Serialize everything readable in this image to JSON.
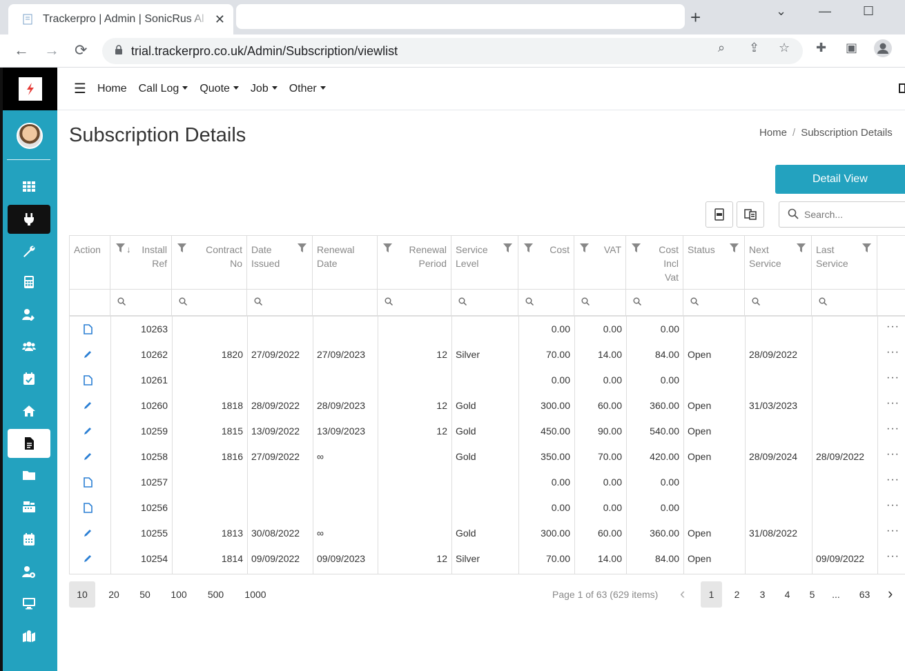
{
  "browser": {
    "tab_title": "Trackerpro | Admin | SonicRus Al",
    "url": "trial.trackerpro.co.uk/Admin/Subscription/viewlist"
  },
  "topnav": {
    "items": [
      {
        "label": "Home",
        "dropdown": false
      },
      {
        "label": "Call Log",
        "dropdown": true
      },
      {
        "label": "Quote",
        "dropdown": true
      },
      {
        "label": "Job",
        "dropdown": true
      },
      {
        "label": "Other",
        "dropdown": true
      }
    ]
  },
  "page": {
    "title": "Subscription Details",
    "breadcrumb": [
      "Home",
      "Subscription Details"
    ],
    "breadcrumb_sep": "/",
    "detail_view_label": "Detail View",
    "search_placeholder": "Search..."
  },
  "colors": {
    "accent": "#23a2bf",
    "sidebar_active": "#111111"
  },
  "sidebar": {
    "icons": [
      "dashboard-grid-icon",
      "plug-icon",
      "wrench-icon",
      "calculator-icon",
      "user-edit-icon",
      "users-icon",
      "calendar-check-icon",
      "home-icon",
      "document-icon",
      "folder-icon",
      "cash-register-icon",
      "calendar-icon",
      "user-cog-icon",
      "desktop-icon",
      "map-icon"
    ]
  },
  "grid": {
    "columns": [
      {
        "key": "action",
        "line1": "Action",
        "line2": "",
        "line3": ""
      },
      {
        "key": "install_ref",
        "line1": "Install",
        "line2": "Ref",
        "line3": ""
      },
      {
        "key": "contract_no",
        "line1": "Contract",
        "line2": "No",
        "line3": ""
      },
      {
        "key": "date_issued",
        "line1": "Date",
        "line2": "Issued",
        "line3": ""
      },
      {
        "key": "renewal_date",
        "line1": "Renewal",
        "line2": "Date",
        "line3": ""
      },
      {
        "key": "renewal_period",
        "line1": "Renewal",
        "line2": "Period",
        "line3": ""
      },
      {
        "key": "service_level",
        "line1": "Service",
        "line2": "Level",
        "line3": ""
      },
      {
        "key": "cost",
        "line1": "Cost",
        "line2": "",
        "line3": ""
      },
      {
        "key": "vat",
        "line1": "VAT",
        "line2": "",
        "line3": ""
      },
      {
        "key": "cost_incl_vat",
        "line1": "Cost",
        "line2": "Incl",
        "line3": "Vat"
      },
      {
        "key": "status",
        "line1": "Status",
        "line2": "",
        "line3": ""
      },
      {
        "key": "next_service",
        "line1": "Next",
        "line2": "Service",
        "line3": ""
      },
      {
        "key": "last_service",
        "line1": "Last",
        "line2": "Service",
        "line3": ""
      }
    ],
    "rows": [
      {
        "action": "view",
        "install_ref": "10263",
        "contract_no": "",
        "date_issued": "",
        "renewal_date": "",
        "renewal_period": "",
        "service_level": "",
        "cost": "0.00",
        "vat": "0.00",
        "cost_incl_vat": "0.00",
        "status": "",
        "next_service": "",
        "last_service": ""
      },
      {
        "action": "edit",
        "install_ref": "10262",
        "contract_no": "1820",
        "date_issued": "27/09/2022",
        "renewal_date": "27/09/2023",
        "renewal_period": "12",
        "service_level": "Silver",
        "cost": "70.00",
        "vat": "14.00",
        "cost_incl_vat": "84.00",
        "status": "Open",
        "next_service": "28/09/2022",
        "last_service": ""
      },
      {
        "action": "view",
        "install_ref": "10261",
        "contract_no": "",
        "date_issued": "",
        "renewal_date": "",
        "renewal_period": "",
        "service_level": "",
        "cost": "0.00",
        "vat": "0.00",
        "cost_incl_vat": "0.00",
        "status": "",
        "next_service": "",
        "last_service": ""
      },
      {
        "action": "edit",
        "install_ref": "10260",
        "contract_no": "1818",
        "date_issued": "28/09/2022",
        "renewal_date": "28/09/2023",
        "renewal_period": "12",
        "service_level": "Gold",
        "cost": "300.00",
        "vat": "60.00",
        "cost_incl_vat": "360.00",
        "status": "Open",
        "next_service": "31/03/2023",
        "last_service": ""
      },
      {
        "action": "edit",
        "install_ref": "10259",
        "contract_no": "1815",
        "date_issued": "13/09/2022",
        "renewal_date": "13/09/2023",
        "renewal_period": "12",
        "service_level": "Gold",
        "cost": "450.00",
        "vat": "90.00",
        "cost_incl_vat": "540.00",
        "status": "Open",
        "next_service": "",
        "last_service": ""
      },
      {
        "action": "edit",
        "install_ref": "10258",
        "contract_no": "1816",
        "date_issued": "27/09/2022",
        "renewal_date": "∞",
        "renewal_period": "",
        "service_level": "Gold",
        "cost": "350.00",
        "vat": "70.00",
        "cost_incl_vat": "420.00",
        "status": "Open",
        "next_service": "28/09/2024",
        "last_service": "28/09/2022"
      },
      {
        "action": "view",
        "install_ref": "10257",
        "contract_no": "",
        "date_issued": "",
        "renewal_date": "",
        "renewal_period": "",
        "service_level": "",
        "cost": "0.00",
        "vat": "0.00",
        "cost_incl_vat": "0.00",
        "status": "",
        "next_service": "",
        "last_service": ""
      },
      {
        "action": "view",
        "install_ref": "10256",
        "contract_no": "",
        "date_issued": "",
        "renewal_date": "",
        "renewal_period": "",
        "service_level": "",
        "cost": "0.00",
        "vat": "0.00",
        "cost_incl_vat": "0.00",
        "status": "",
        "next_service": "",
        "last_service": ""
      },
      {
        "action": "edit",
        "install_ref": "10255",
        "contract_no": "1813",
        "date_issued": "30/08/2022",
        "renewal_date": "∞",
        "renewal_period": "",
        "service_level": "Gold",
        "cost": "300.00",
        "vat": "60.00",
        "cost_incl_vat": "360.00",
        "status": "Open",
        "next_service": "31/08/2022",
        "last_service": ""
      },
      {
        "action": "edit",
        "install_ref": "10254",
        "contract_no": "1814",
        "date_issued": "09/09/2022",
        "renewal_date": "09/09/2023",
        "renewal_period": "12",
        "service_level": "Silver",
        "cost": "70.00",
        "vat": "14.00",
        "cost_incl_vat": "84.00",
        "status": "Open",
        "next_service": "",
        "last_service": "09/09/2022"
      }
    ],
    "more_label": "···"
  },
  "pager": {
    "page_sizes": [
      "10",
      "20",
      "50",
      "100",
      "500",
      "1000"
    ],
    "selected_size": "10",
    "info": "Page 1 of 63 (629 items)",
    "pages": [
      "1",
      "2",
      "3",
      "4",
      "5",
      "...",
      "63"
    ],
    "current_page": "1"
  }
}
